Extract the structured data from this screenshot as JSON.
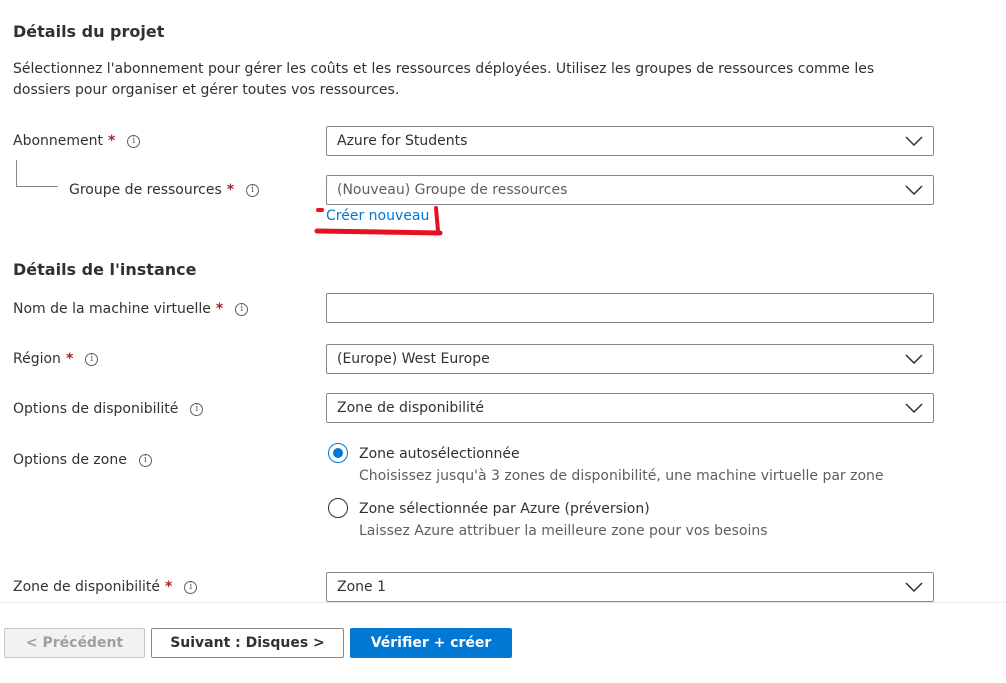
{
  "project": {
    "title": "Détails du projet",
    "description": "Sélectionnez l'abonnement pour gérer les coûts et les ressources déployées. Utilisez les groupes de ressources comme les dossiers pour organiser et gérer toutes vos ressources.",
    "subscription": {
      "label": "Abonnement",
      "required": "*",
      "value": "Azure for Students"
    },
    "resource_group": {
      "label": "Groupe de ressources",
      "required": "*",
      "placeholder": "(Nouveau) Groupe de ressources",
      "create_link": "Créer nouveau"
    }
  },
  "instance": {
    "title": "Détails de l'instance",
    "vm_name": {
      "label": "Nom de la machine virtuelle",
      "required": "*",
      "value": ""
    },
    "region": {
      "label": "Région",
      "required": "*",
      "value": "(Europe) West Europe"
    },
    "availability_options": {
      "label": "Options de disponibilité",
      "value": "Zone de disponibilité"
    },
    "zone_options": {
      "label": "Options de zone",
      "options": [
        {
          "title": "Zone autosélectionnée",
          "description": "Choisissez jusqu'à 3 zones de disponibilité, une machine virtuelle par zone",
          "selected": true
        },
        {
          "title": "Zone sélectionnée par Azure (préversion)",
          "description": "Laissez Azure attribuer la meilleure zone pour vos besoins",
          "selected": false
        }
      ]
    },
    "availability_zone": {
      "label": "Zone de disponibilité",
      "required": "*",
      "value": "Zone 1"
    }
  },
  "footer": {
    "previous_label": "< Précédent",
    "next_label": "Suivant : Disques >",
    "review_label": "Vérifier + créer"
  },
  "colors": {
    "accent": "#0078d4",
    "required": "#a4262c",
    "annotation_red": "#e81123"
  },
  "icons": {
    "info": "info-icon",
    "dropdown": "chevron-down-icon"
  }
}
